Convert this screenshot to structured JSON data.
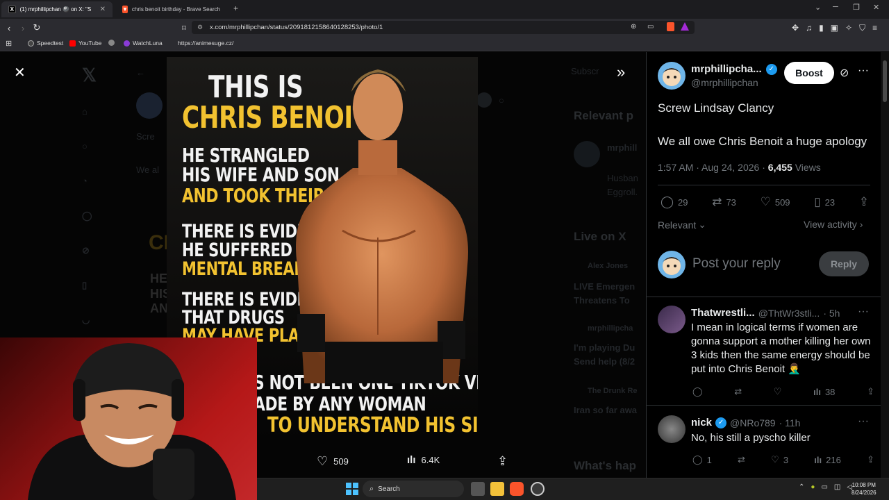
{
  "browser": {
    "tabs": [
      {
        "title": "(1) mrphillipchan 🎱 on X: \"S",
        "favicon": "X",
        "active": true
      },
      {
        "title": "chris benoit birthday - Brave Search",
        "favicon": "brave",
        "active": false
      }
    ],
    "url": "x.com/mrphillipchan/status/2091812158640128253/photo/1",
    "bookmarks": [
      "Speedtest",
      "YouTube",
      "WatchLuna",
      "https://animesuge.cz/"
    ]
  },
  "viewer": {
    "poster": {
      "line1": "THIS IS",
      "line2": "CHRIS BENOIT.",
      "line3": "HE STRANGLED",
      "line4": "HIS WIFE AND SON",
      "line5": "AND TOOK THEIR LIVES.",
      "line6": "THERE IS EVIDENCE",
      "line7": "HE SUFFERED A",
      "line8": "MENTAL BREAK.",
      "line9": "THERE IS EVIDENCE",
      "line10": "THAT DRUGS",
      "line11": "MAY HAVE PLAYED",
      "line12": "S NOT BEEN ONE TIKTOK VIDEO",
      "line13": "ADE BY ANY WOMAN",
      "line14": "TO UNDERSTAND HIS SIDE."
    },
    "actions": {
      "likes": "509",
      "views": "6.4K"
    },
    "background": {
      "relevant": "Relevant p",
      "live": "Live on X",
      "whats": "What's hap",
      "screw": "Scre",
      "weall": "We al",
      "husband": "Husban",
      "eggroll": "Eggroll.",
      "alex": "Alex Jones",
      "live_emerg": "LIVE Emergen",
      "threatens": "Threatens To",
      "mrph": "mrphillipcha",
      "playing": "I'm playing Du",
      "sendhelp": "Send help (8/2",
      "drunk": "The Drunk Re",
      "iran": "Iran so far awa",
      "mrph2": "mrphill",
      "subscribe": "Subscr"
    }
  },
  "tweet": {
    "name": "mrphillipcha...",
    "handle": "@mrphillipchan",
    "boost_label": "Boost",
    "text_line1": "Screw Lindsay Clancy",
    "text_line2": "We all owe Chris Benoit a huge apology",
    "time": "1:57 AM · Aug 24, 2026 · ",
    "views_count": "6,455",
    "views_label": " Views",
    "replies": "29",
    "reposts": "73",
    "likes": "509",
    "bookmarks": "23",
    "sort_label": "Relevant",
    "view_activity": "View activity",
    "reply_placeholder": "Post your reply",
    "reply_button": "Reply"
  },
  "replies": [
    {
      "name": "Thatwrestli...",
      "handle": "@ThtWr3stli...",
      "time": "· 5h",
      "text": "I mean in logical terms if women are gonna support a mother killing her own 3 kids then the same energy should be put into Chris Benoit 🤦‍♂️",
      "replies": "",
      "reposts": "",
      "likes": "",
      "views": "38"
    },
    {
      "name": "nick",
      "handle": "@NRo789",
      "time": "· 11h",
      "text": "No, his still a pyscho killer",
      "replies": "1",
      "reposts": "",
      "likes": "3",
      "views": "216"
    }
  ],
  "taskbar": {
    "search": "Search",
    "time": "10:08 PM",
    "date": "8/24/2026"
  },
  "colors": {
    "accent": "#1d9bf0",
    "poster_yellow": "#f2c230",
    "webcam_red": "#b51818"
  }
}
